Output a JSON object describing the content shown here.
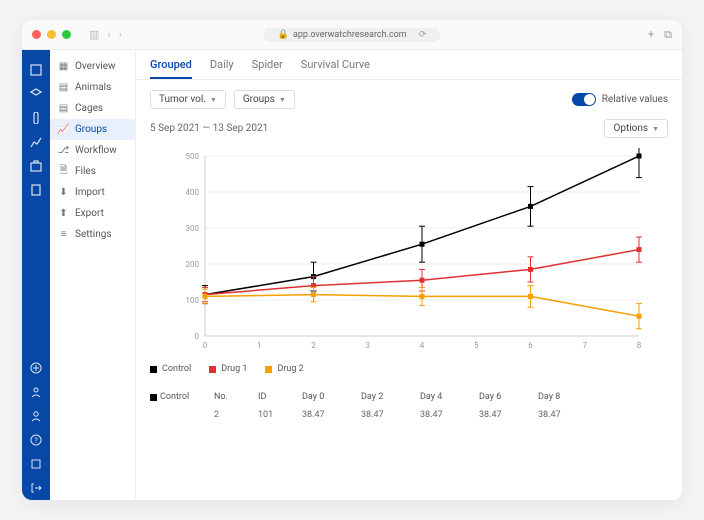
{
  "url": "app.overwatchresearch.com",
  "sidenav": {
    "items": [
      {
        "label": "Overview",
        "icon": "overview"
      },
      {
        "label": "Animals",
        "icon": "grid"
      },
      {
        "label": "Cages",
        "icon": "grid"
      },
      {
        "label": "Groups",
        "icon": "chart"
      },
      {
        "label": "Workflow",
        "icon": "flow"
      },
      {
        "label": "Files",
        "icon": "file"
      },
      {
        "label": "Import",
        "icon": "import"
      },
      {
        "label": "Export",
        "icon": "export"
      },
      {
        "label": "Settings",
        "icon": "settings"
      }
    ],
    "activeIndex": 3
  },
  "tabs": {
    "items": [
      "Grouped",
      "Daily",
      "Spider",
      "Survival Curve"
    ],
    "activeIndex": 0
  },
  "filters": {
    "measure": "Tumor vol.",
    "grouping": "Groups"
  },
  "toggle_label": "Relative values",
  "date_range": "5 Sep 2021 — 13 Sep 2021",
  "options_label": "Options",
  "legend": [
    {
      "name": "Control",
      "color": "#000000"
    },
    {
      "name": "Drug 1",
      "color": "#e03131"
    },
    {
      "name": "Drug 2",
      "color": "#f59f00"
    }
  ],
  "table": {
    "headers": [
      "",
      "No.",
      "ID",
      "Day 0",
      "Day 2",
      "Day 4",
      "Day 6",
      "Day 8"
    ],
    "group": "Control",
    "row": [
      "",
      "2",
      "101",
      "38.47",
      "38.47",
      "38.47",
      "38.47",
      "38.47"
    ]
  },
  "chart_data": {
    "type": "line",
    "xlabel": "",
    "ylabel": "",
    "x": [
      0,
      1,
      2,
      3,
      4,
      5,
      6,
      7,
      8
    ],
    "ylim": [
      0,
      500
    ],
    "yticks": [
      0,
      100,
      200,
      300,
      400,
      500
    ],
    "series": [
      {
        "name": "Control",
        "color": "#000000",
        "x": [
          0,
          2,
          4,
          6,
          8
        ],
        "y": [
          115,
          165,
          255,
          360,
          500
        ],
        "err": [
          25,
          40,
          50,
          55,
          60
        ]
      },
      {
        "name": "Drug 1",
        "color": "#e03131",
        "x": [
          0,
          2,
          4,
          6,
          8
        ],
        "y": [
          115,
          140,
          155,
          185,
          240
        ],
        "err": [
          20,
          25,
          30,
          35,
          35
        ]
      },
      {
        "name": "Drug 2",
        "color": "#f59f00",
        "x": [
          0,
          2,
          4,
          6,
          8
        ],
        "y": [
          110,
          115,
          110,
          110,
          55
        ],
        "err": [
          20,
          20,
          25,
          30,
          35
        ]
      }
    ]
  }
}
